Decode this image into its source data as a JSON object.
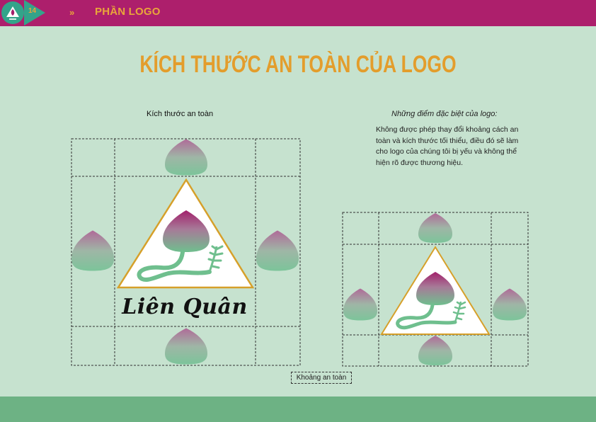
{
  "header": {
    "page_number": "14",
    "chevron": "»",
    "section_title": "PHẦN LOGO"
  },
  "title": "KÍCH THƯỚC AN TOÀN CỦA LOGO",
  "left_caption": "Kích thước an toàn",
  "right_caption": "Những điểm đặc biệt của logo:",
  "note": "Không được phép thay đổi khoảng cách an toàn và kích thước tối thiểu, điều đó sẽ làm cho logo của chúng tôi bị yếu và không thể hiện rõ được thương hiệu.",
  "brand_name": "Liên Quân",
  "safe_zone_label": "Khoảng an toàn",
  "colors": {
    "header_bg": "#ad1f6c",
    "accent_orange": "#e39d2c",
    "badge_teal": "#33a48a",
    "page_bg": "#c6e2cf",
    "footer_bg": "#6db284",
    "lotus_top": "#a2206b",
    "lotus_bottom": "#6fbf8e",
    "triangle_border": "#d6a02a"
  },
  "icons": [
    "lotus-bud-icon",
    "lotus-logo-icon"
  ]
}
